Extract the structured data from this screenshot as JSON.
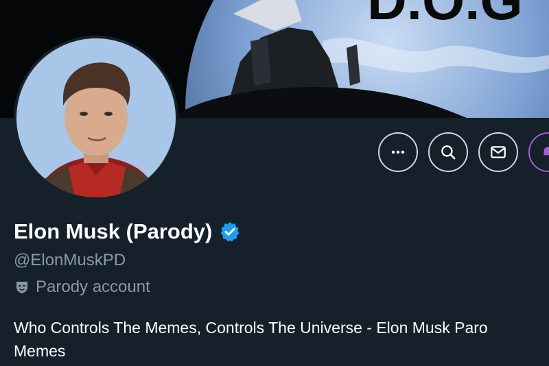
{
  "profile": {
    "display_name": "Elon Musk (Parody)",
    "handle": "@ElonMuskPD",
    "label": "Parody account",
    "bio_line1": "Who Controls The Memes, Controls The Universe - Elon Musk Paro",
    "bio_line2": "Memes",
    "verified_color": "#1d9bf0"
  },
  "banner": {
    "text_fragment": "D.O.G"
  },
  "actions": {
    "icons": [
      "more-icon",
      "search-icon",
      "message-icon"
    ],
    "partial_button_color": "#a35fd3"
  },
  "colors": {
    "background": "#15202b",
    "muted_text": "#8b98a5",
    "border": "#cfd9de"
  }
}
